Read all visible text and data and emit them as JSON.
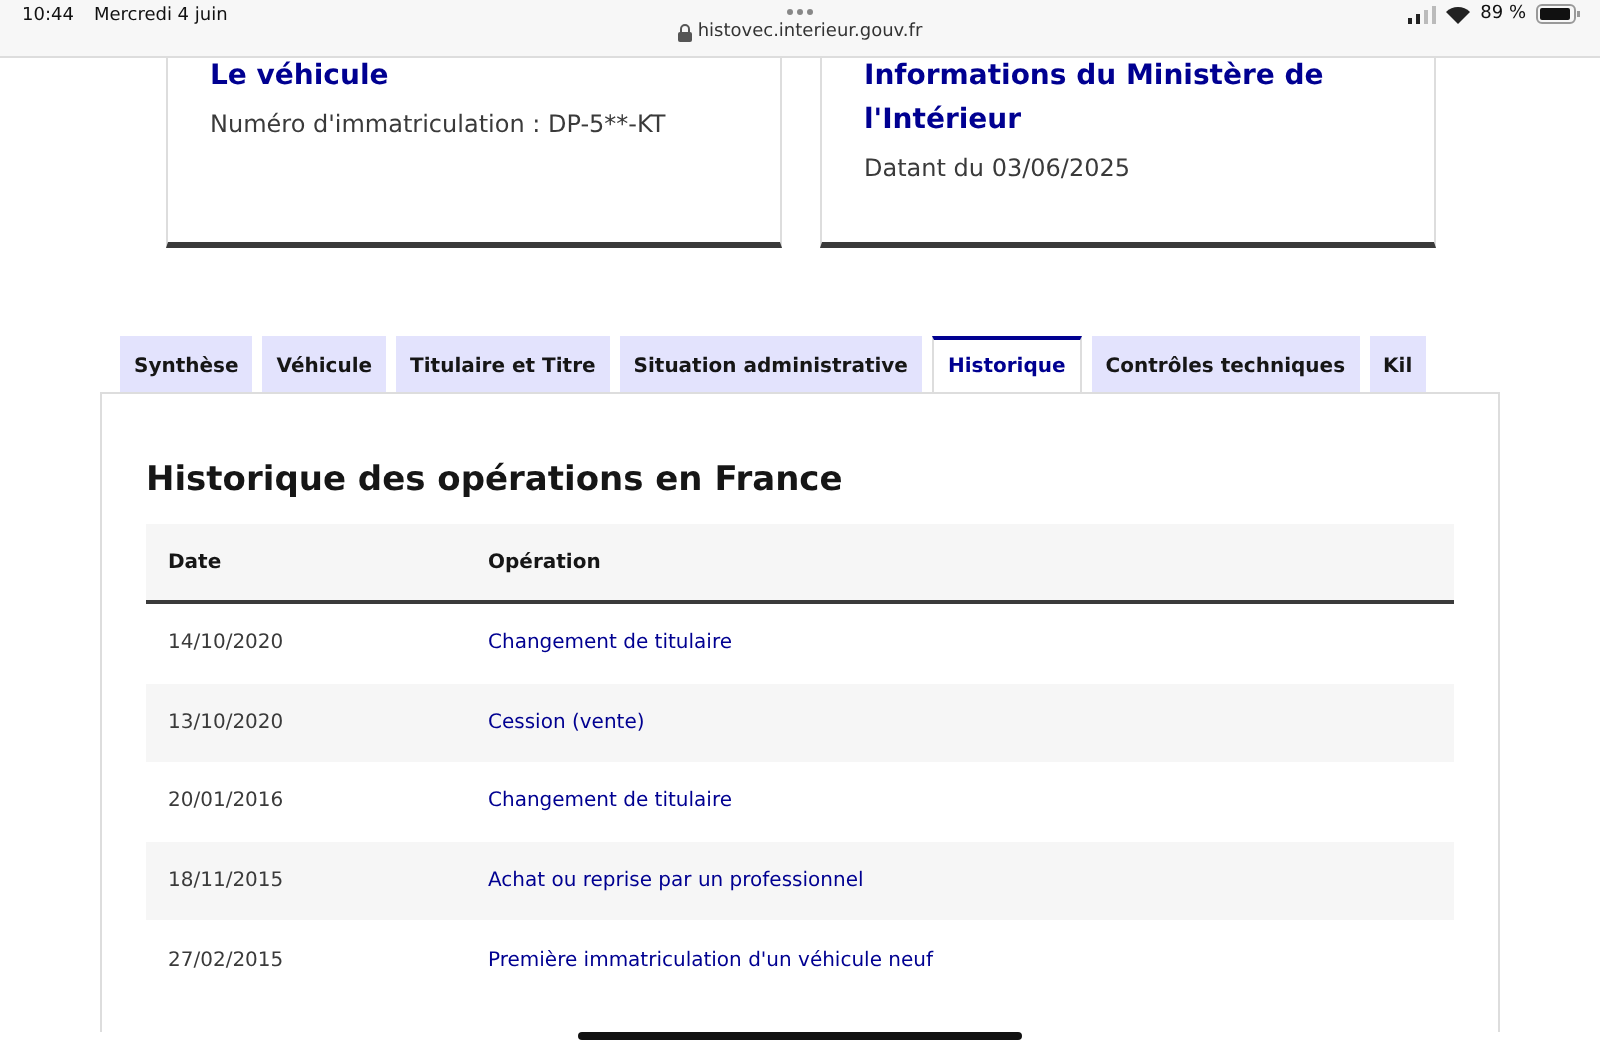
{
  "status_bar": {
    "time": "10:44",
    "date": "Mercredi 4 juin",
    "url": "histovec.interieur.gouv.fr",
    "battery": "89 %"
  },
  "cards": [
    {
      "title": "Le véhicule",
      "text": "Numéro d'immatriculation : DP-5**-KT"
    },
    {
      "title": "Informations du Ministère de l'Intérieur",
      "text": "Datant du 03/06/2025"
    }
  ],
  "tabs": [
    {
      "label": "Synthèse",
      "selected": false
    },
    {
      "label": "Véhicule",
      "selected": false
    },
    {
      "label": "Titulaire et Titre",
      "selected": false
    },
    {
      "label": "Situation administrative",
      "selected": false
    },
    {
      "label": "Historique",
      "selected": true
    },
    {
      "label": "Contrôles techniques",
      "selected": false
    },
    {
      "label": "Kil",
      "selected": false
    }
  ],
  "panel": {
    "title": "Historique des opérations en France",
    "table": {
      "columns": [
        "Date",
        "Opération"
      ],
      "rows": [
        [
          "14/10/2020",
          "Changement de titulaire"
        ],
        [
          "13/10/2020",
          "Cession (vente)"
        ],
        [
          "20/01/2016",
          "Changement de titulaire"
        ],
        [
          "18/11/2015",
          "Achat ou reprise par un professionnel"
        ],
        [
          "27/02/2015",
          "Première immatriculation d'un véhicule neuf"
        ]
      ]
    }
  }
}
